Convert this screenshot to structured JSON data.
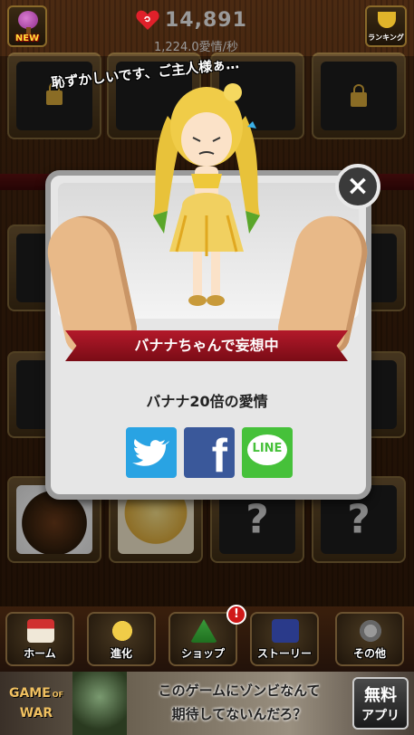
{
  "header": {
    "new_label": "NEW",
    "score": "14,891",
    "rate": "1,224.0愛情/秒",
    "ranking_label": "ランキング"
  },
  "caption": "恥ずかしいです、ご主人様ぁ…",
  "tiles": {
    "question_mark": "?"
  },
  "dialog": {
    "close_glyph": "×",
    "ribbon": "バナナちゃんで妄想中",
    "love_text": "バナナ20倍の愛情",
    "share": {
      "twitter": "twitter",
      "facebook_glyph": "f",
      "line": "LINE"
    }
  },
  "nav": {
    "items": [
      {
        "label": "ホーム"
      },
      {
        "label": "進化"
      },
      {
        "label": "ショップ"
      },
      {
        "label": "ストーリー"
      },
      {
        "label": "その他"
      }
    ],
    "badge": "!"
  },
  "ad": {
    "logo_line1": "GAME",
    "logo_line2": "OF",
    "logo_line3": "WAR",
    "headline_line1": "このゲームにゾンビなんて",
    "headline_line2": "期待してないんだろ？",
    "button_line1": "無料",
    "button_line2": "アプリ"
  },
  "colors": {
    "ribbon": "#b3192a",
    "twitter": "#29a3e3",
    "facebook": "#3a589a",
    "line": "#46c13a"
  }
}
